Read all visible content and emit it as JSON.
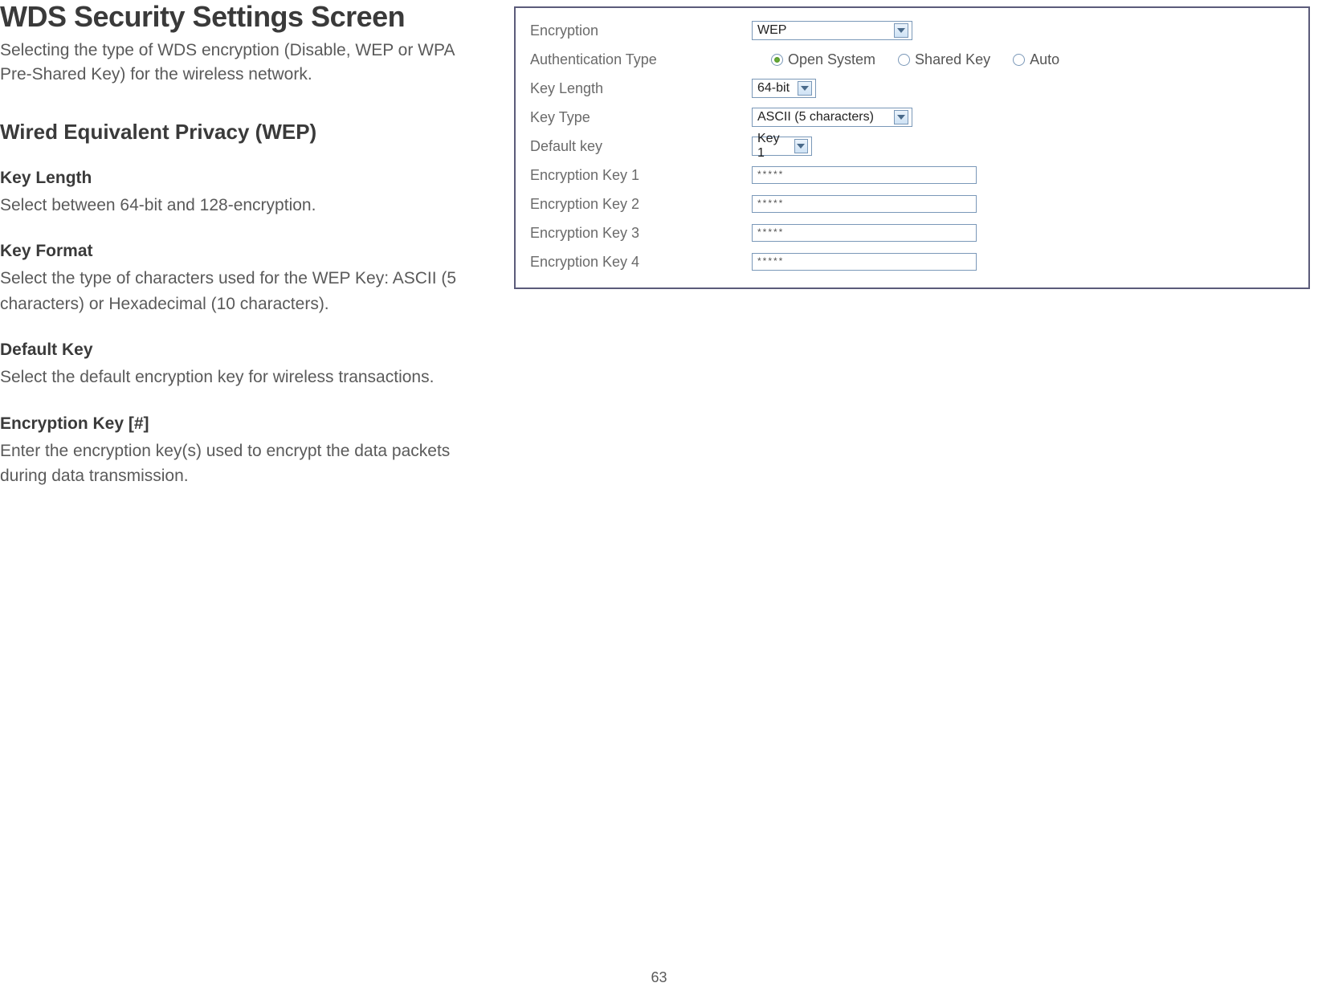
{
  "doc": {
    "title": "WDS Security Settings Screen",
    "intro": "Selecting the type of WDS encryption (Disable, WEP or WPA Pre-Shared Key) for the wireless network.",
    "section_title": "Wired Equivalent Privacy (WEP)",
    "subs": [
      {
        "title": "Key Length",
        "desc": "Select between 64-bit and 128-encryption."
      },
      {
        "title": "Key Format",
        "desc": "Select the type of characters used for the WEP Key: ASCII (5 characters) or Hexadecimal (10 characters)."
      },
      {
        "title": "Default Key",
        "desc": "Select the default encryption key for wireless transactions."
      },
      {
        "title": "Encryption Key [#]",
        "desc": "Enter the encryption key(s) used to encrypt the data packets during data transmission."
      }
    ],
    "page_number": "63"
  },
  "panel": {
    "labels": {
      "encryption": "Encryption",
      "auth_type": "Authentication Type",
      "key_length": "Key Length",
      "key_type": "Key Type",
      "default_key": "Default key",
      "enc_key_1": "Encryption Key 1",
      "enc_key_2": "Encryption Key 2",
      "enc_key_3": "Encryption Key 3",
      "enc_key_4": "Encryption Key 4"
    },
    "values": {
      "encryption": "WEP",
      "key_length": "64-bit",
      "key_type": "ASCII (5 characters)",
      "default_key": "Key 1",
      "enc_key_1": "*****",
      "enc_key_2": "*****",
      "enc_key_3": "*****",
      "enc_key_4": "*****"
    },
    "auth_options": {
      "open": "Open System",
      "shared": "Shared Key",
      "auto": "Auto",
      "selected": "open"
    }
  }
}
